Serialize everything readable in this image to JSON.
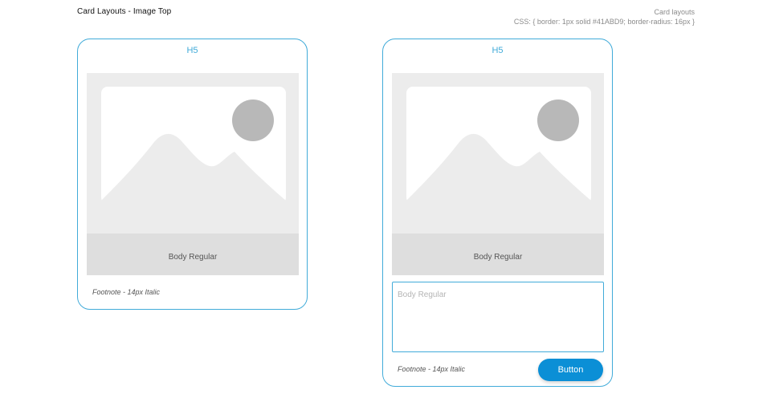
{
  "page": {
    "title": "Card Layouts - Image Top",
    "spec": {
      "line1": "Card layouts",
      "line2": "CSS: { border: 1px solid #41ABD9; border-radius: 16px }"
    }
  },
  "card1": {
    "title": "H5",
    "image_caption": "Body Regular",
    "footnote": "Footnote - 14px Italic"
  },
  "card2": {
    "title": "H5",
    "image_caption": "Body Regular",
    "textarea_placeholder": "Body Regular",
    "footnote": "Footnote - 14px Italic",
    "button_label": "Button"
  },
  "colors": {
    "accent": "#41ABD9",
    "button": "#0b8fd6",
    "placeholder_bg": "#ececec",
    "placeholder_band": "#dedede"
  },
  "icons": {
    "image_placeholder": "image-placeholder-icon"
  }
}
